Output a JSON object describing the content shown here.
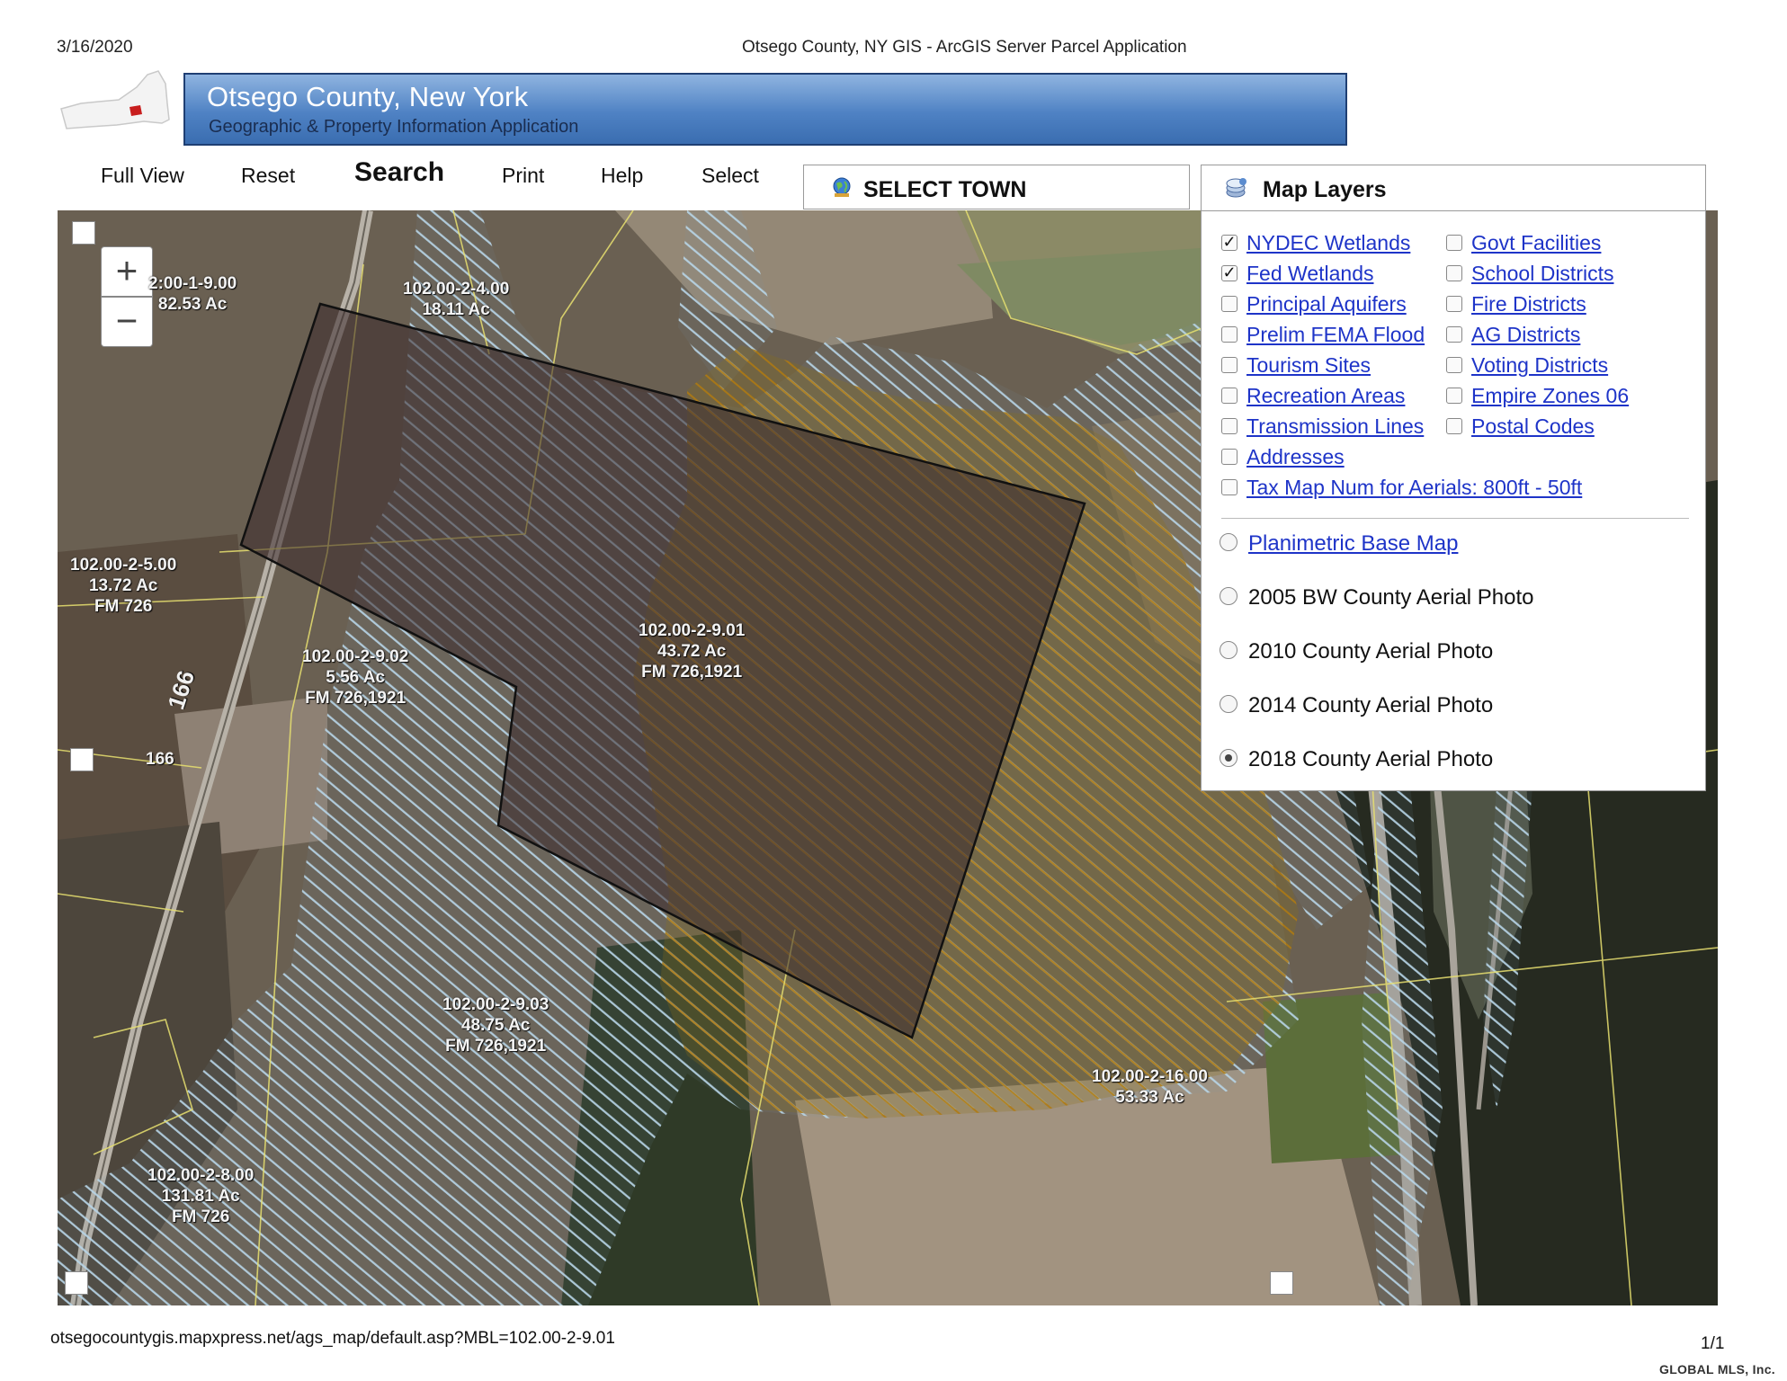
{
  "print": {
    "date": "3/16/2020",
    "title": "Otsego County, NY GIS - ArcGIS Server Parcel Application",
    "url": "otsegocountygis.mapxpress.net/ags_map/default.asp?MBL=102.00-2-9.01",
    "page": "1/1",
    "watermark": "GLOBAL MLS, Inc."
  },
  "banner": {
    "title": "Otsego County, New York",
    "subtitle": "Geographic & Property Information Application"
  },
  "toolbar": {
    "full_view": "Full View",
    "reset": "Reset",
    "search": "Search",
    "print": "Print",
    "help": "Help",
    "select": "Select"
  },
  "select_town": {
    "label": "SELECT TOWN",
    "icon": "globe-icon"
  },
  "zoom": {
    "in": "+",
    "out": "−"
  },
  "map": {
    "parcels": [
      {
        "lines": [
          "2:00-1-9.00",
          "82.53 Ac"
        ]
      },
      {
        "lines": [
          "102.00-2-4.00",
          "18.11 Ac"
        ]
      },
      {
        "lines": [
          "102.00-2-5.00",
          "13.72 Ac",
          "FM 726"
        ]
      },
      {
        "lines": [
          "102.00-2-9.02",
          "5.56 Ac",
          "FM 726,1921"
        ]
      },
      {
        "lines": [
          "102.00-2-9.01",
          "43.72 Ac",
          "FM 726,1921"
        ]
      },
      {
        "lines": [
          "102.00-2-9.03",
          "48.75 Ac",
          "FM 726,1921"
        ]
      },
      {
        "lines": [
          "102.00-2-16.00",
          "53.33 Ac"
        ]
      },
      {
        "lines": [
          "102.00-2-8.00",
          "131.81 Ac",
          "FM 726"
        ]
      }
    ],
    "road_labels": [
      "166",
      "166"
    ],
    "colors": {
      "selected_parcel_fill": "#3a2a2c",
      "wetland_hatch": "#b8d6e8",
      "fema_hatch": "#b07a10",
      "parcel_line": "#e8e070"
    }
  },
  "layers": {
    "title": "Map Layers",
    "icon": "layers-icon",
    "left": [
      {
        "label": "NYDEC Wetlands",
        "checked": true
      },
      {
        "label": "Fed Wetlands",
        "checked": true
      },
      {
        "label": "Principal Aquifers",
        "checked": false
      },
      {
        "label": "Prelim FEMA Flood",
        "checked": false
      },
      {
        "label": "Tourism Sites",
        "checked": false
      },
      {
        "label": "Recreation Areas",
        "checked": false
      },
      {
        "label": "Transmission Lines",
        "checked": false
      },
      {
        "label": "Addresses",
        "checked": false
      },
      {
        "label": "Tax Map Num for Aerials: 800ft - 50ft",
        "checked": false
      }
    ],
    "right": [
      {
        "label": "Govt Facilities",
        "checked": false
      },
      {
        "label": "School Districts",
        "checked": false
      },
      {
        "label": "Fire Districts",
        "checked": false
      },
      {
        "label": "AG Districts",
        "checked": false
      },
      {
        "label": "Voting Districts",
        "checked": false
      },
      {
        "label": "Empire Zones 06",
        "checked": false
      },
      {
        "label": "Postal Codes",
        "checked": false
      }
    ],
    "base_maps": [
      {
        "label": "Planimetric Base Map",
        "selected": false,
        "link": true
      },
      {
        "label": "2005 BW County Aerial Photo",
        "selected": false,
        "link": false
      },
      {
        "label": "2010 County Aerial Photo",
        "selected": false,
        "link": false
      },
      {
        "label": "2014 County Aerial Photo",
        "selected": false,
        "link": false
      },
      {
        "label": "2018 County Aerial Photo",
        "selected": true,
        "link": false
      }
    ]
  }
}
